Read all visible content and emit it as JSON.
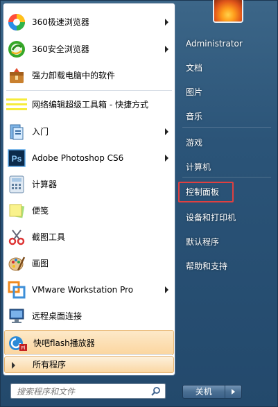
{
  "programs": [
    {
      "label": "360极速浏览器",
      "icon": "360-speed-browser-icon",
      "arrow": true
    },
    {
      "label": "360安全浏览器",
      "icon": "360-safe-browser-icon",
      "arrow": true
    },
    {
      "label": "强力卸载电脑中的软件",
      "icon": "uninstaller-icon",
      "arrow": false
    },
    {
      "label": "网络编辑超级工具箱 - 快捷方式",
      "icon": "editor-toolbox-icon",
      "arrow": false
    },
    {
      "label": "入门",
      "icon": "getting-started-icon",
      "arrow": true
    },
    {
      "label": "Adobe Photoshop CS6",
      "icon": "photoshop-icon",
      "arrow": true
    },
    {
      "label": "计算器",
      "icon": "calculator-icon",
      "arrow": false
    },
    {
      "label": "便笺",
      "icon": "sticky-notes-icon",
      "arrow": false
    },
    {
      "label": "截图工具",
      "icon": "snipping-tool-icon",
      "arrow": false
    },
    {
      "label": "画图",
      "icon": "paint-icon",
      "arrow": false
    },
    {
      "label": "VMware Workstation Pro",
      "icon": "vmware-icon",
      "arrow": true
    },
    {
      "label": "远程桌面连接",
      "icon": "remote-desktop-icon",
      "arrow": false
    },
    {
      "label": "快吧flash播放器",
      "icon": "flash-player-icon",
      "arrow": false
    }
  ],
  "ps_text": "Ps",
  "flash_text": "Fl",
  "all_programs": "所有程序",
  "search": {
    "placeholder": "搜索程序和文件"
  },
  "right": {
    "user": "Administrator",
    "documents": "文档",
    "pictures": "图片",
    "music": "音乐",
    "games": "游戏",
    "computer": "计算机",
    "control_panel": "控制面板",
    "devices": "设备和打印机",
    "default_programs": "默认程序",
    "help": "帮助和支持"
  },
  "shutdown": {
    "label": "关机"
  },
  "colors": {
    "highlight_border": "#e04040",
    "menu_bg": "#2b5478"
  }
}
